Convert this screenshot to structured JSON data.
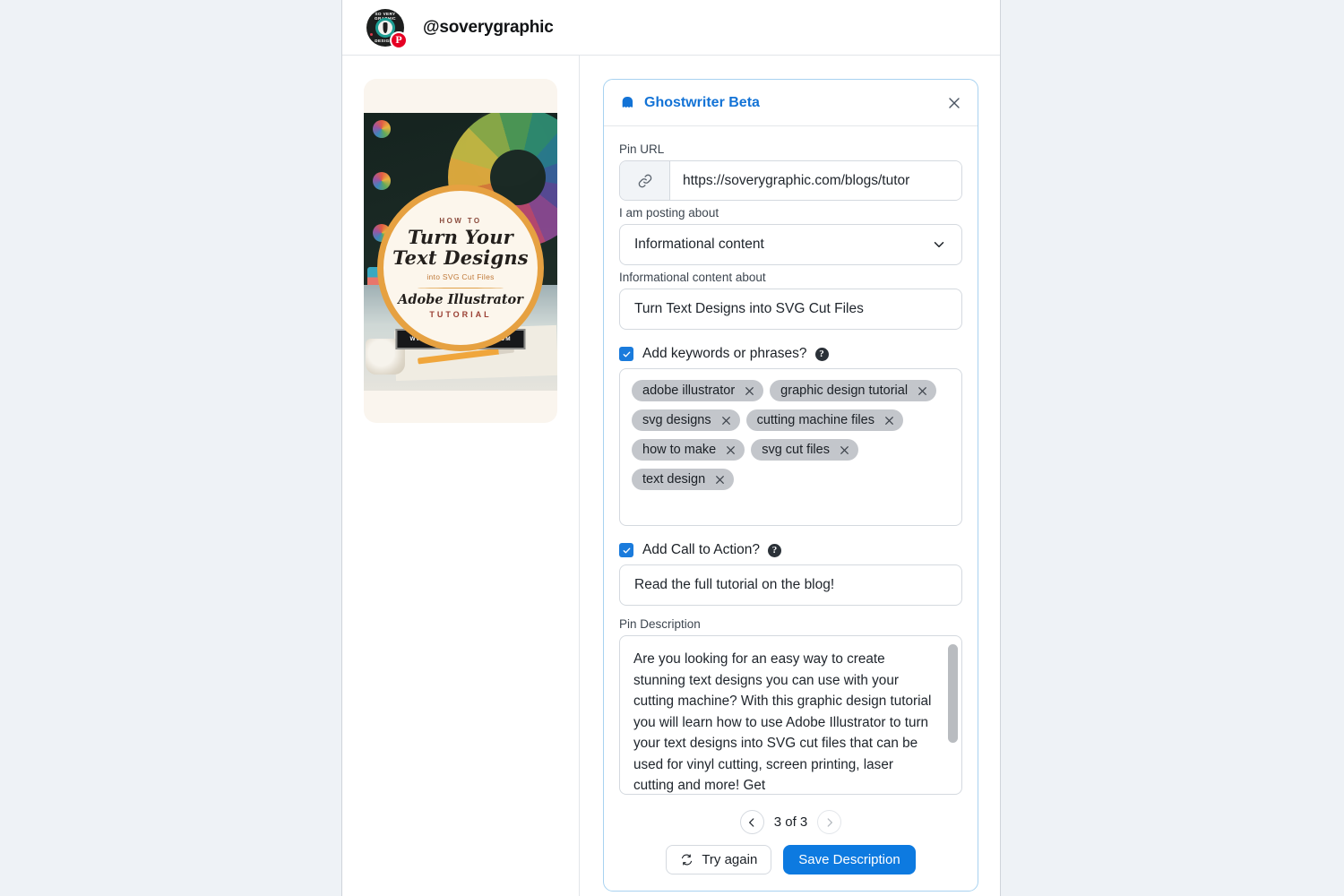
{
  "account": {
    "handle": "@soverygraphic",
    "avatar_text_top": "SO VERY GRAPHIC",
    "avatar_text_bottom": "DESIGNS",
    "pinterest_badge": "P"
  },
  "pin_preview": {
    "how_to": "HOW TO",
    "headline_line1": "Turn Your",
    "headline_line2": "Text Designs",
    "subline": "into SVG Cut Files",
    "program": "Adobe Illustrator",
    "tutorial": "TUTORIAL",
    "website": "WWW.SOVERYGRAPHIC.COM"
  },
  "panel": {
    "title": "Ghostwriter Beta",
    "close_label": "×",
    "pin_url": {
      "label": "Pin URL",
      "value": "https://soverygraphic.com/blogs/tutor"
    },
    "posting_about": {
      "label": "I am posting about",
      "value": "Informational content"
    },
    "content_about": {
      "label": "Informational content about",
      "value": "Turn Text Designs into SVG Cut Files"
    },
    "keywords": {
      "checkbox_label": "Add keywords or phrases?",
      "checked": true,
      "items": [
        "adobe illustrator",
        "graphic design tutorial",
        "svg designs",
        "cutting machine files",
        "how to make",
        "svg cut files",
        "text design"
      ]
    },
    "call_to_action": {
      "checkbox_label": "Add Call to Action?",
      "checked": true,
      "value": "Read the full tutorial on the blog!"
    },
    "description": {
      "label": "Pin Description",
      "value": "Are you looking for an easy way to create stunning text designs you can use with your cutting machine? With this graphic design tutorial you will learn how to use Adobe Illustrator to turn your text designs into SVG cut files that can be used for vinyl cutting, screen printing, laser cutting and more! Get"
    },
    "pager": {
      "label": "3 of 3",
      "prev_enabled": true,
      "next_enabled": false
    },
    "actions": {
      "try_again": "Try again",
      "save": "Save Description"
    }
  },
  "colors": {
    "accent_blue": "#1373d6",
    "primary_button": "#0d7ae0",
    "panel_border": "#a8d2f0",
    "page_background": "#eef2f6",
    "chip_background": "#c3c6cb"
  }
}
